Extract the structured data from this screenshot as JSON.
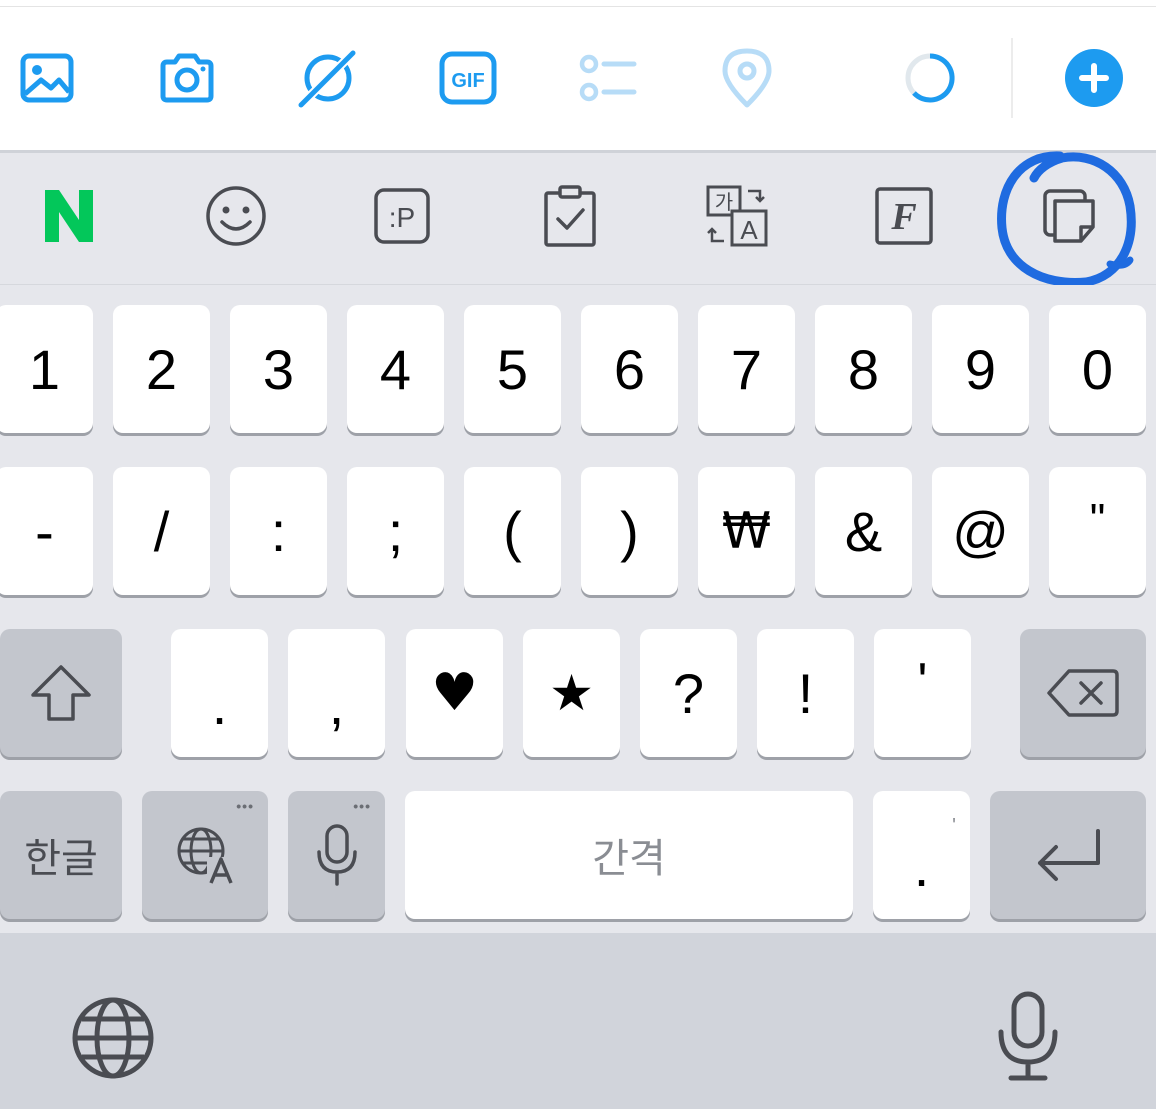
{
  "toolbar": {
    "icons": [
      "image-icon",
      "camera-icon",
      "spark-icon",
      "gif-icon",
      "poll-icon",
      "location-icon",
      "character-count-ring-icon",
      "add-icon"
    ],
    "gif_label": "GIF",
    "accent": "#1d9bf0",
    "disabled_accent": "#b7dcf7"
  },
  "strip": {
    "naver_label": "N",
    "naver_color": "#03c75a",
    "sticker_label": ":P",
    "translate_label_top": "가",
    "translate_label_bottom": "A",
    "font_label": "F",
    "highlight_color": "#1f6be0"
  },
  "keyboard": {
    "row1": [
      "1",
      "2",
      "3",
      "4",
      "5",
      "6",
      "7",
      "8",
      "9",
      "0"
    ],
    "row2": [
      "-",
      "/",
      ":",
      ";",
      "(",
      ")",
      "₩",
      "&",
      "@",
      "\""
    ],
    "row3": [
      ".",
      ",",
      "♥",
      "★",
      "?",
      "!",
      "'"
    ],
    "hangul_label": "한글",
    "space_label": "간격",
    "period_label": ".",
    "period_alt": "'",
    "dots": "•••"
  }
}
